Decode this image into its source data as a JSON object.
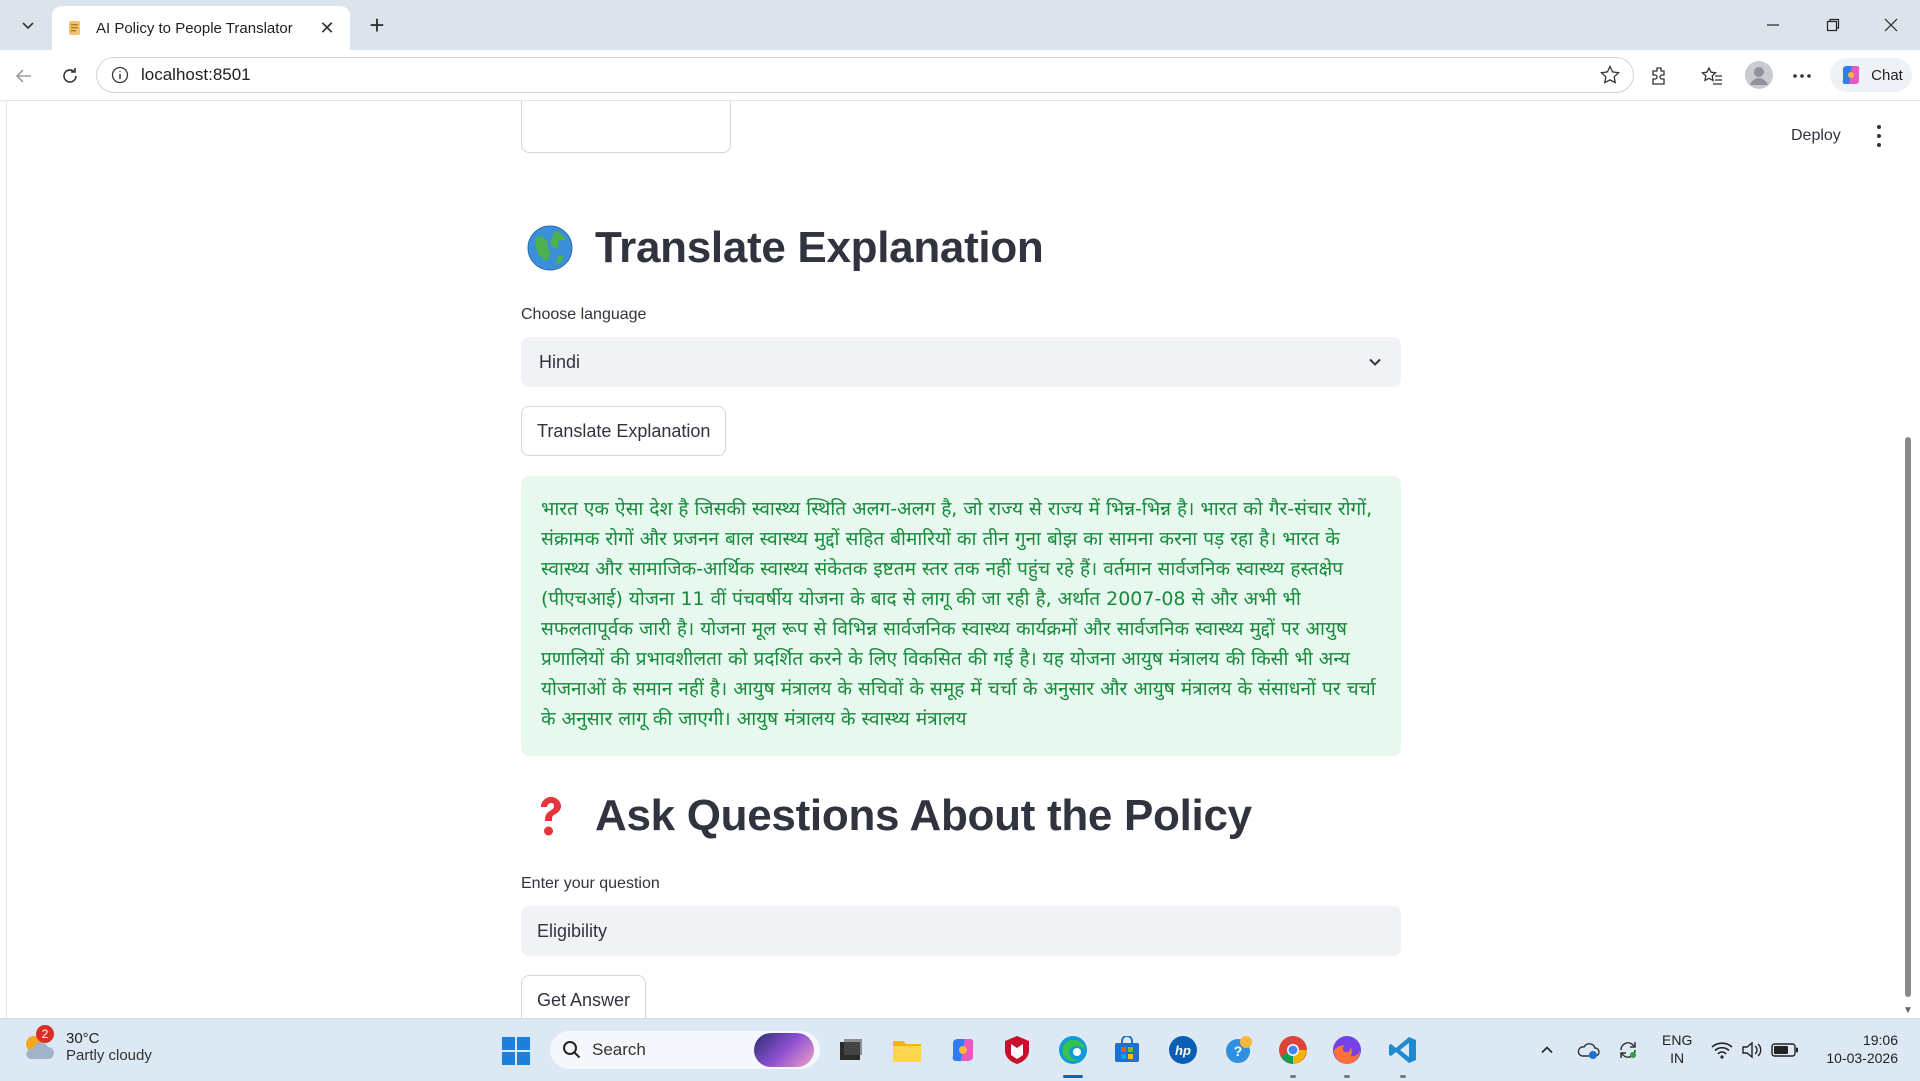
{
  "browser": {
    "tab_title": "AI Policy to People Translator",
    "url": "localhost:8501",
    "chat_label": "Chat"
  },
  "app_header": {
    "deploy_label": "Deploy"
  },
  "translate_section": {
    "emoji": "globe-emoji",
    "heading": "Translate Explanation",
    "language_label": "Choose language",
    "language_value": "Hindi",
    "button_label": "Translate Explanation",
    "translated_text": "भारत एक ऐसा देश है जिसकी स्वास्थ्य स्थिति अलग-अलग है, जो राज्य से राज्य में भिन्न-भिन्न है। भारत को गैर-संचार रोगों, संक्रामक रोगों और प्रजनन बाल स्वास्थ्य मुद्दों सहित बीमारियों का तीन गुना बोझ का सामना करना पड़ रहा है। भारत के स्वास्थ्य और सामाजिक-आर्थिक स्वास्थ्य संकेतक इष्टतम स्तर तक नहीं पहुंच रहे हैं। वर्तमान सार्वजनिक स्वास्थ्य हस्तक्षेप (पीएचआई) योजना 11 वीं पंचवर्षीय योजना के बाद से लागू की जा रही है, अर्थात 2007-08 से और अभी भी सफलतापूर्वक जारी है। योजना मूल रूप से विभिन्न सार्वजनिक स्वास्थ्य कार्यक्रमों और सार्वजनिक स्वास्थ्य मुद्दों पर आयुष प्रणालियों की प्रभावशीलता को प्रदर्शित करने के लिए विकसित की गई है। यह योजना आयुष मंत्रालय की किसी भी अन्य योजनाओं के समान नहीं है। आयुष मंत्रालय के सचिवों के समूह में चर्चा के अनुसार और आयुष मंत्रालय के संसाधनों पर चर्चा के अनुसार लागू की जाएगी। आयुष मंत्रालय के स्वास्थ्य मंत्रालय"
  },
  "qa_section": {
    "emoji": "question-mark-emoji",
    "heading": "Ask Questions About the Policy",
    "question_label": "Enter your question",
    "question_value": "Eligibility",
    "button_label": "Get Answer"
  },
  "taskbar": {
    "weather_badge": "2",
    "temperature": "30°C",
    "condition": "Partly cloudy",
    "search_placeholder": "Search",
    "lang_line1": "ENG",
    "lang_line2": "IN",
    "time": "19:06",
    "date": "10-03-2026"
  },
  "colors": {
    "accent_blue": "#0067c0",
    "success_bg": "#e7f9ee",
    "success_text": "#178a3c",
    "input_bg": "#f0f2f6"
  }
}
